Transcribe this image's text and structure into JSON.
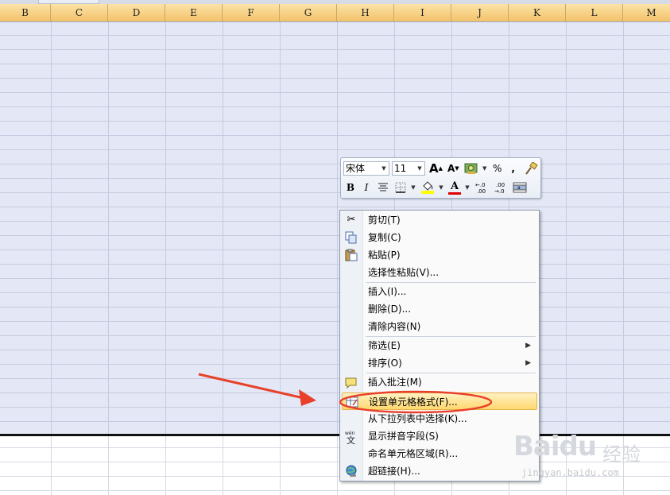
{
  "sheet": {
    "columns": [
      "B",
      "C",
      "D",
      "E",
      "F",
      "G",
      "H",
      "I",
      "J",
      "K",
      "L",
      "M"
    ]
  },
  "mini_toolbar": {
    "font_name": "宋体",
    "font_size": "11",
    "grow_font": "A",
    "shrink_font": "A",
    "percent": "%",
    "comma": ",",
    "bold": "B",
    "italic": "I",
    "font_color": "A",
    "increase_decimal": "+.0\n.00",
    "decrease_decimal": ".00\n→.0",
    "colors": {
      "fill": "#ffff00",
      "font": "#e00000"
    }
  },
  "context_menu": {
    "items": [
      {
        "label": "剪切(T)",
        "icon": "scissors-icon"
      },
      {
        "label": "复制(C)",
        "icon": "copy-icon"
      },
      {
        "label": "粘贴(P)",
        "icon": "paste-icon"
      },
      {
        "label": "选择性粘贴(V)...",
        "icon": ""
      },
      {
        "label": "插入(I)...",
        "icon": ""
      },
      {
        "label": "删除(D)...",
        "icon": ""
      },
      {
        "label": "清除内容(N)",
        "icon": ""
      },
      {
        "label": "筛选(E)",
        "icon": "",
        "submenu": true
      },
      {
        "label": "排序(O)",
        "icon": "",
        "submenu": true
      },
      {
        "label": "插入批注(M)",
        "icon": "comment-icon"
      },
      {
        "label": "设置单元格格式(F)...",
        "icon": "format-cells-icon",
        "highlighted": true
      },
      {
        "label": "从下拉列表中选择(K)...",
        "icon": ""
      },
      {
        "label": "显示拼音字段(S)",
        "icon": "phonetic-icon"
      },
      {
        "label": "命名单元格区域(R)...",
        "icon": ""
      },
      {
        "label": "超链接(H)...",
        "icon": "hyperlink-icon"
      }
    ],
    "submenu_arrow": "▶"
  },
  "annotation": {
    "arrow_color": "#e8402a",
    "ellipse_color": "#e8402a"
  },
  "watermark": {
    "main": "Baidu",
    "sub": "经验",
    "url": "jingyan.baidu.com"
  }
}
